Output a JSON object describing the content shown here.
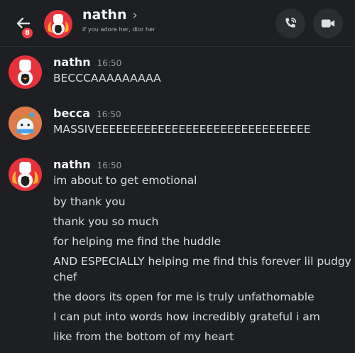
{
  "header": {
    "unread_count": "8",
    "title": "nathn",
    "chevron": "›",
    "status": "if you adore her, dior her"
  },
  "icons": {
    "back": "arrow-left-icon",
    "call": "phone-icon",
    "video": "video-camera-icon"
  },
  "colors": {
    "background": "#1e1f22",
    "badge": "#f23f43",
    "nathn_avatar_bg": "#e8323a",
    "becca_avatar_bg": "#e07a4a"
  },
  "messages": [
    {
      "author": "nathn",
      "time": "16:50",
      "lines": [
        "BECCCAAAAAAAAA"
      ]
    },
    {
      "author": "becca",
      "time": "16:50",
      "lines": [
        "MASSIVEEEEEEEEEEEEEEEEEEEEEEEEEEEEEEE"
      ]
    },
    {
      "author": "nathn",
      "time": "16:50",
      "lines": [
        "im about to get emotional",
        "by thank you",
        "thank you so much",
        "for helping me find the huddle",
        "AND ESPECIALLY helping me find this forever lil pudgy",
        "chef",
        "the doors its open for me is truly unfathomable",
        "I can put into words how incredibly grateful i am",
        "like from the bottom of my heart"
      ]
    }
  ]
}
